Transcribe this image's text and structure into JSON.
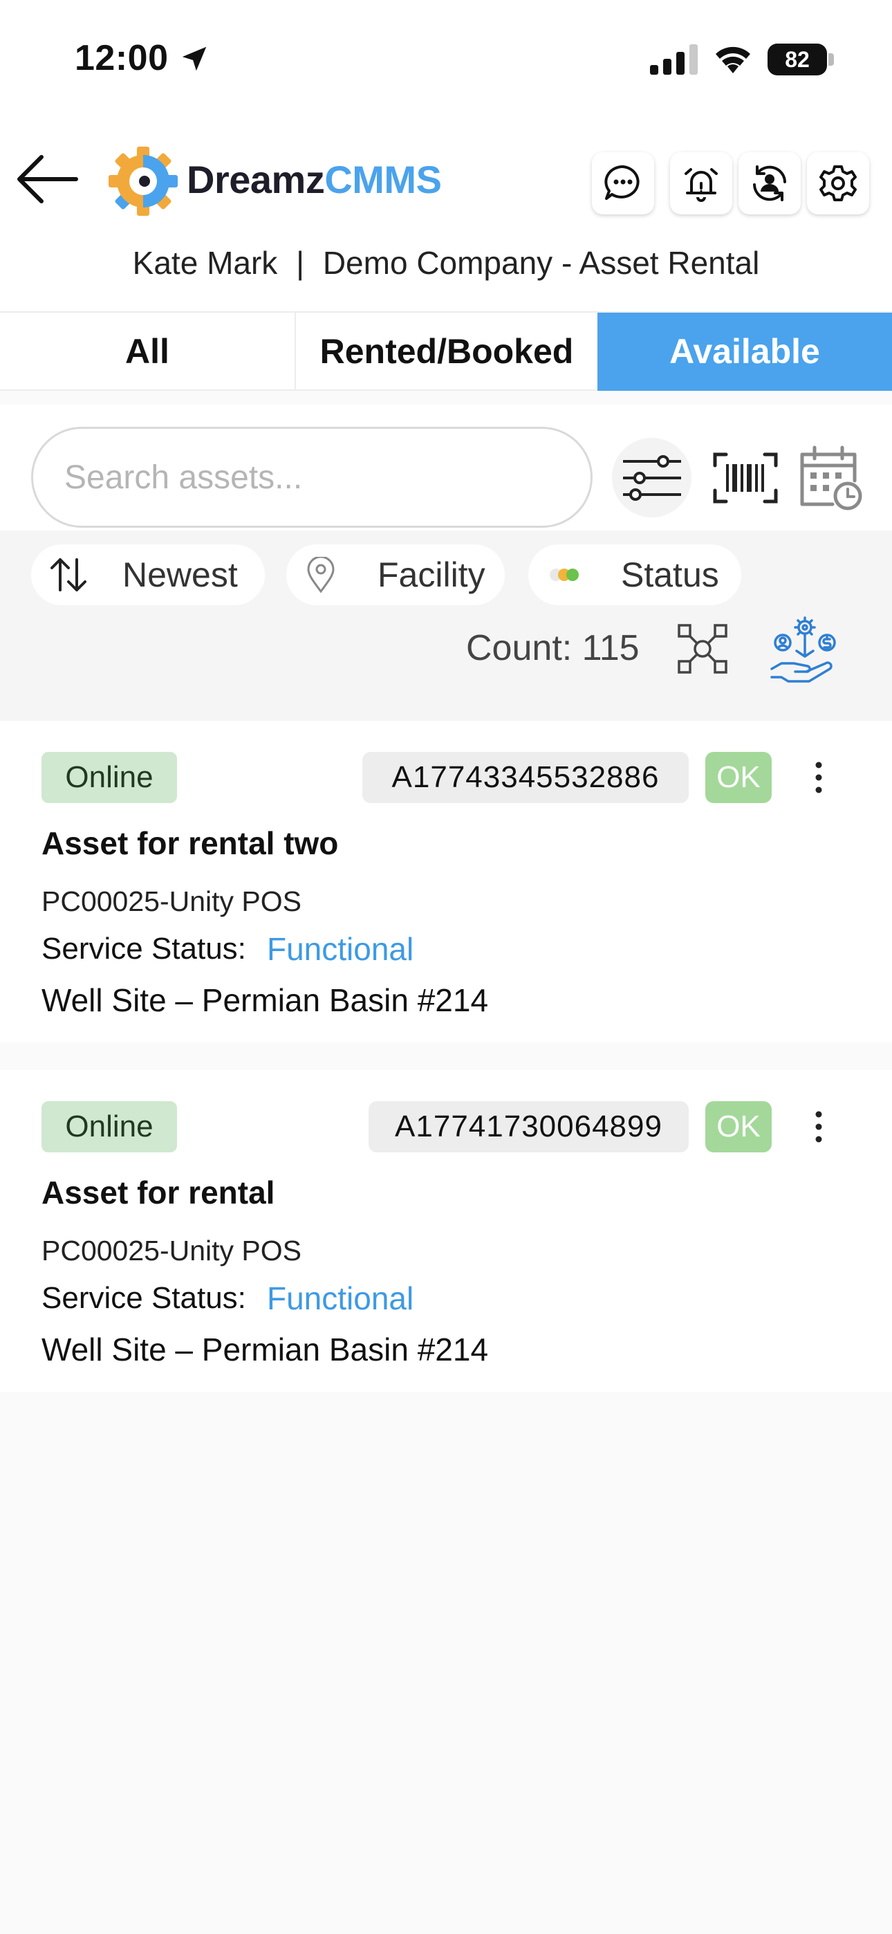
{
  "status_bar": {
    "time": "12:00",
    "battery": "82"
  },
  "header": {
    "logo_part1": "Dreamz",
    "logo_part2": "CMMS",
    "user_name": "Kate Mark",
    "separator": "|",
    "company": "Demo Company - Asset Rental"
  },
  "tabs": [
    {
      "label": "All",
      "active": false
    },
    {
      "label": "Rented/Booked",
      "active": false
    },
    {
      "label": "Available",
      "active": true
    }
  ],
  "search": {
    "placeholder": "Search assets..."
  },
  "chips": {
    "sort": "Newest",
    "facility": "Facility",
    "status": "Status"
  },
  "count_text": "Count: 115",
  "colors": {
    "accent": "#4aa3ec",
    "online_bg": "#cfe8cf",
    "ok_bg": "#a4d89a",
    "link": "#3d9ae4"
  },
  "assets": [
    {
      "status": "Online",
      "id": "A17743345532886",
      "condition": "OK",
      "name": "Asset for rental two",
      "code": "PC00025-Unity POS",
      "service_label": "Service Status:",
      "service_value": "Functional",
      "location": "Well Site – Permian Basin #214"
    },
    {
      "status": "Online",
      "id": "A17741730064899",
      "condition": "OK",
      "name": "Asset for rental",
      "code": "PC00025-Unity POS",
      "service_label": "Service Status:",
      "service_value": "Functional",
      "location": "Well Site – Permian Basin #214"
    }
  ]
}
